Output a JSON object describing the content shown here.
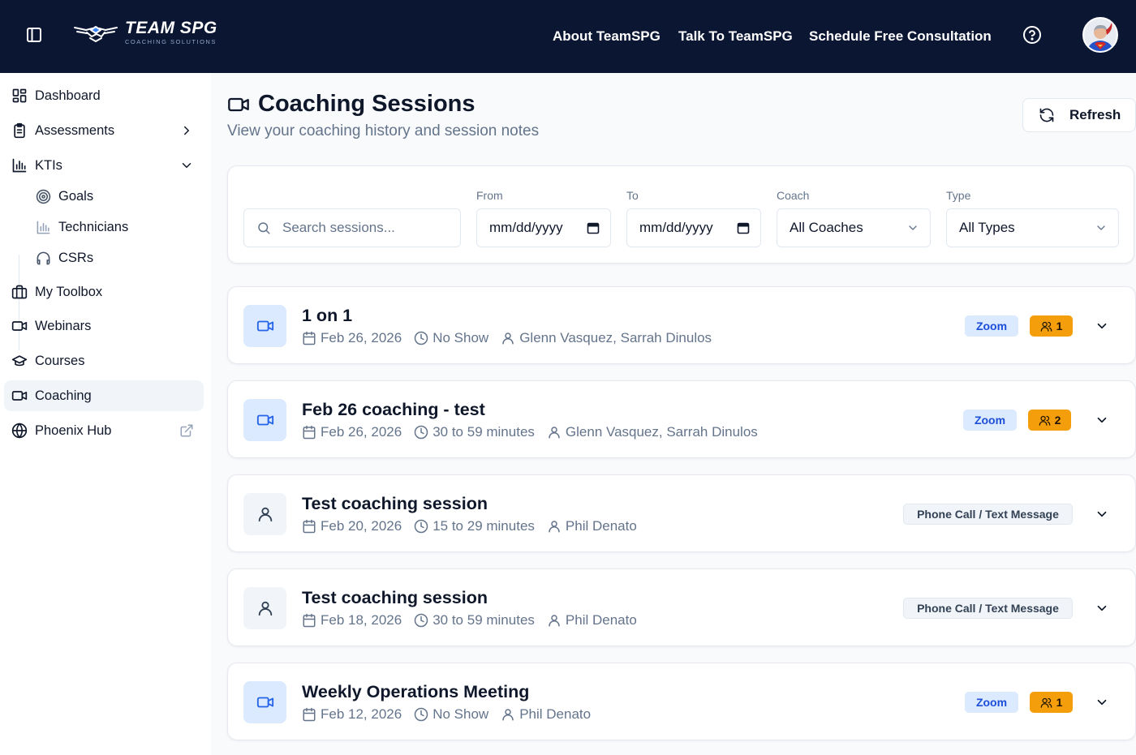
{
  "header": {
    "brand_name": "TEAM SPG",
    "brand_tagline": "COACHING SOLUTIONS",
    "nav": [
      "About TeamSPG",
      "Talk To TeamSPG",
      "Schedule Free Consultation"
    ],
    "icons": {
      "sidebar_toggle": "panel-left-icon",
      "help": "help-circle-icon",
      "avatar": "user-avatar"
    }
  },
  "sidebar": {
    "items": [
      {
        "label": "Dashboard",
        "icon": "layout-dashboard-icon"
      },
      {
        "label": "Assessments",
        "icon": "clipboard-list-icon"
      },
      {
        "label": "KTIs",
        "icon": "bar-chart-icon"
      },
      {
        "label": "My Toolbox",
        "icon": "briefcase-icon"
      },
      {
        "label": "Webinars",
        "icon": "video-icon"
      },
      {
        "label": "Courses",
        "icon": "graduation-cap-icon"
      },
      {
        "label": "Coaching",
        "icon": "video-icon",
        "active": true
      },
      {
        "label": "Phoenix Hub",
        "icon": "globe-icon"
      }
    ],
    "kti_subitems": [
      {
        "label": "Goals",
        "icon": "target-icon"
      },
      {
        "label": "Technicians",
        "icon": "bar-chart-icon"
      },
      {
        "label": "CSRs",
        "icon": "headphones-icon"
      }
    ]
  },
  "page": {
    "title": "Coaching Sessions",
    "subtitle": "View your coaching history and session notes",
    "refresh_label": "Refresh"
  },
  "filters": {
    "search_placeholder": "Search sessions...",
    "from_label": "From",
    "from_value": "mm/dd/yyyy",
    "to_label": "To",
    "to_value": "mm/dd/yyyy",
    "coach_label": "Coach",
    "coach_value": "All Coaches",
    "type_label": "Type",
    "type_value": "All Types"
  },
  "sessions": [
    {
      "title": "1 on 1",
      "date": "Feb 26, 2026",
      "duration": "No Show",
      "people": "Glenn Vasquez, Sarrah Dinulos",
      "type": "Zoom",
      "count": "1",
      "icon": "video-icon"
    },
    {
      "title": "Feb 26 coaching - test",
      "date": "Feb 26, 2026",
      "duration": "30 to 59 minutes",
      "people": "Glenn Vasquez, Sarrah Dinulos",
      "type": "Zoom",
      "count": "2",
      "icon": "video-icon"
    },
    {
      "title": "Test coaching session",
      "date": "Feb 20, 2026",
      "duration": "15 to 29 minutes",
      "people": "Phil Denato",
      "type": "Phone Call / Text Message",
      "count": "",
      "icon": "user-icon"
    },
    {
      "title": "Test coaching session",
      "date": "Feb 18, 2026",
      "duration": "30 to 59 minutes",
      "people": "Phil Denato",
      "type": "Phone Call / Text Message",
      "count": "",
      "icon": "user-icon"
    },
    {
      "title": "Weekly Operations Meeting",
      "date": "Feb 12, 2026",
      "duration": "No Show",
      "people": "Phil Denato",
      "type": "Zoom",
      "count": "1",
      "icon": "video-icon"
    }
  ],
  "colors": {
    "header_bg": "#0b1633",
    "zoom_badge_bg": "#dbeafe",
    "zoom_badge_text": "#1d4ed8",
    "count_badge_bg": "#f59e0b"
  }
}
